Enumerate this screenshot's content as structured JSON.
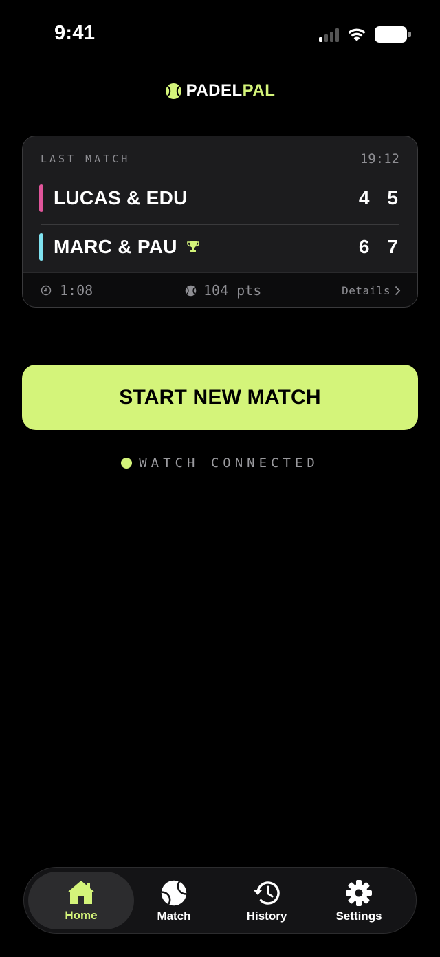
{
  "status_bar": {
    "time": "9:41"
  },
  "brand": {
    "name_part1": "PADEL",
    "name_part2": "PAL",
    "accent_color": "#d4f47a"
  },
  "last_match": {
    "label": "LAST MATCH",
    "time": "19:12",
    "teams": [
      {
        "name": "LUCAS & EDU",
        "color": "#e0559a",
        "scores": [
          "4",
          "5"
        ],
        "winner": false
      },
      {
        "name": "MARC & PAU",
        "color": "#7fe2f0",
        "scores": [
          "6",
          "7"
        ],
        "winner": true
      }
    ],
    "duration": "1:08",
    "points": "104 pts",
    "details_label": "Details"
  },
  "start_button": {
    "label": "START NEW MATCH"
  },
  "watch": {
    "status": "WATCH CONNECTED",
    "dot_color": "#d4f47a"
  },
  "tabbar": {
    "items": [
      {
        "label": "Home",
        "icon": "home-icon",
        "active": true
      },
      {
        "label": "Match",
        "icon": "tennis-ball-icon",
        "active": false
      },
      {
        "label": "History",
        "icon": "history-icon",
        "active": false
      },
      {
        "label": "Settings",
        "icon": "gear-icon",
        "active": false
      }
    ]
  }
}
